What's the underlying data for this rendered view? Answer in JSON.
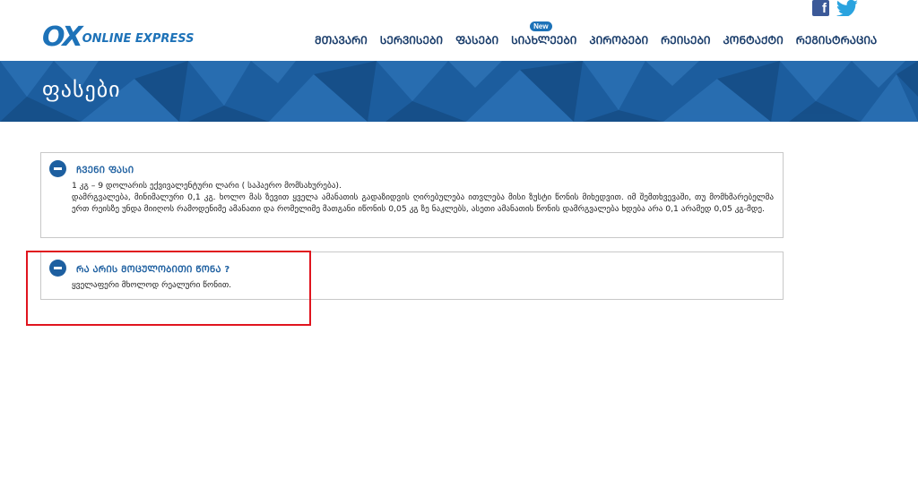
{
  "header": {
    "logo_mark": "OX",
    "logo_text": "ONLINE EXPRESS",
    "social": {
      "facebook_glyph": "f",
      "twitter_glyph": "🐦",
      "facebook_icon": "facebook-icon",
      "twitter_icon": "twitter-icon"
    },
    "nav": [
      {
        "label": "ᲛᲗᲐᲕᲐᲠᲘ"
      },
      {
        "label": "ᲡᲔᲠᲕᲘᲡᲔᲑᲘ"
      },
      {
        "label": "ᲤᲐᲡᲔᲑᲘ"
      },
      {
        "label": "ᲡᲘᲐᲮᲚᲔᲔᲑᲘ",
        "badge": "New"
      },
      {
        "label": "ᲞᲘᲠᲝᲑᲔᲑᲘ"
      },
      {
        "label": "ᲠᲔᲘᲡᲔᲑᲘ"
      },
      {
        "label": "ᲙᲝᲜᲢᲐᲥᲢᲘ"
      },
      {
        "label": "ᲠᲔᲒᲘᲡᲢᲠᲐᲪᲘᲐ"
      }
    ]
  },
  "banner": {
    "title": "ფასები"
  },
  "faq": [
    {
      "title": "ᲩᲕᲔᲜᲘ ᲤᲐᲡᲘ",
      "lines": [
        "1 კგ – 9 დოლარის ექვივალენტური ლარი ( საჰაერო მომსახურება).",
        "დამრგვალება, მინიმალური 0,1 კგ. ხოლო მას ზევით ყველა ამანათის გადაზიდვის ღირებულება ითვლება მისი ზუსტი წონის მიხედვით. იმ შემთხვევაში, თუ მომხმარებელმა ერთ რეისზე უნდა მიიღოს რამოდენიმე ამანათი და რომელიმე მათგანი იწონის 0,05 კგ ზე ნაკლებს, ასეთი ამანათის წონის დამრგვალება ხდება არა 0,1 არამედ 0,05 კგ-მდე."
      ]
    },
    {
      "title": "ᲠᲐ ᲐᲠᲘᲡ ᲛᲝᲪᲣᲚᲝᲑᲘᲗᲘ ᲬᲝᲜᲐ ?",
      "lines": [
        "ყველაფერი მხოლოდ რეალური წონით."
      ]
    }
  ],
  "colors": {
    "brand": "#1d72b8",
    "banner": "#1c5d9e",
    "highlight": "#e0141e"
  }
}
